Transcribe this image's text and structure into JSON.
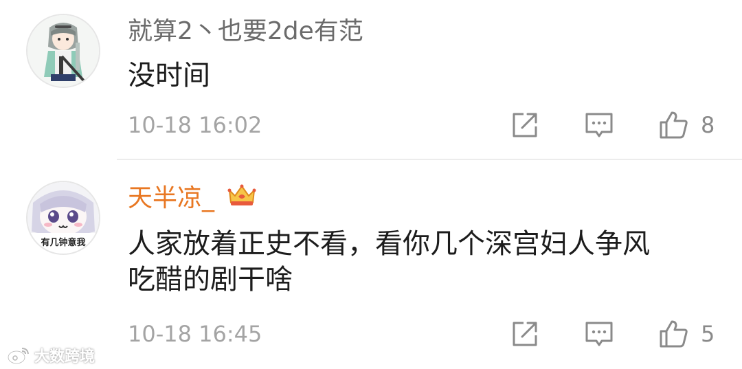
{
  "comments": [
    {
      "username": "就算2丶也要2de有范",
      "content": "没时间",
      "timestamp": "10-18 16:02",
      "like_count": "8",
      "avatar_icon": "anime-girl-with-rifle-avatar"
    },
    {
      "username": "天半凉_",
      "username_color": "#e87722",
      "badge_icon": "crown-icon",
      "content": "人家放着正史不看，看你几个深宫妇人争风\n吃醋的剧干啥",
      "timestamp": "10-18 16:45",
      "like_count": "5",
      "avatar_icon": "anime-girl-meme-avatar",
      "avatar_caption": "有几钟意我"
    }
  ],
  "watermark": {
    "text": "大数跨境",
    "icon": "weibo-logo-icon"
  },
  "colors": {
    "username": "#6b6b6b",
    "vip_username": "#e87722",
    "content": "#1c1c1c",
    "meta": "#a4a4a4",
    "icon": "#8a8a8a"
  }
}
